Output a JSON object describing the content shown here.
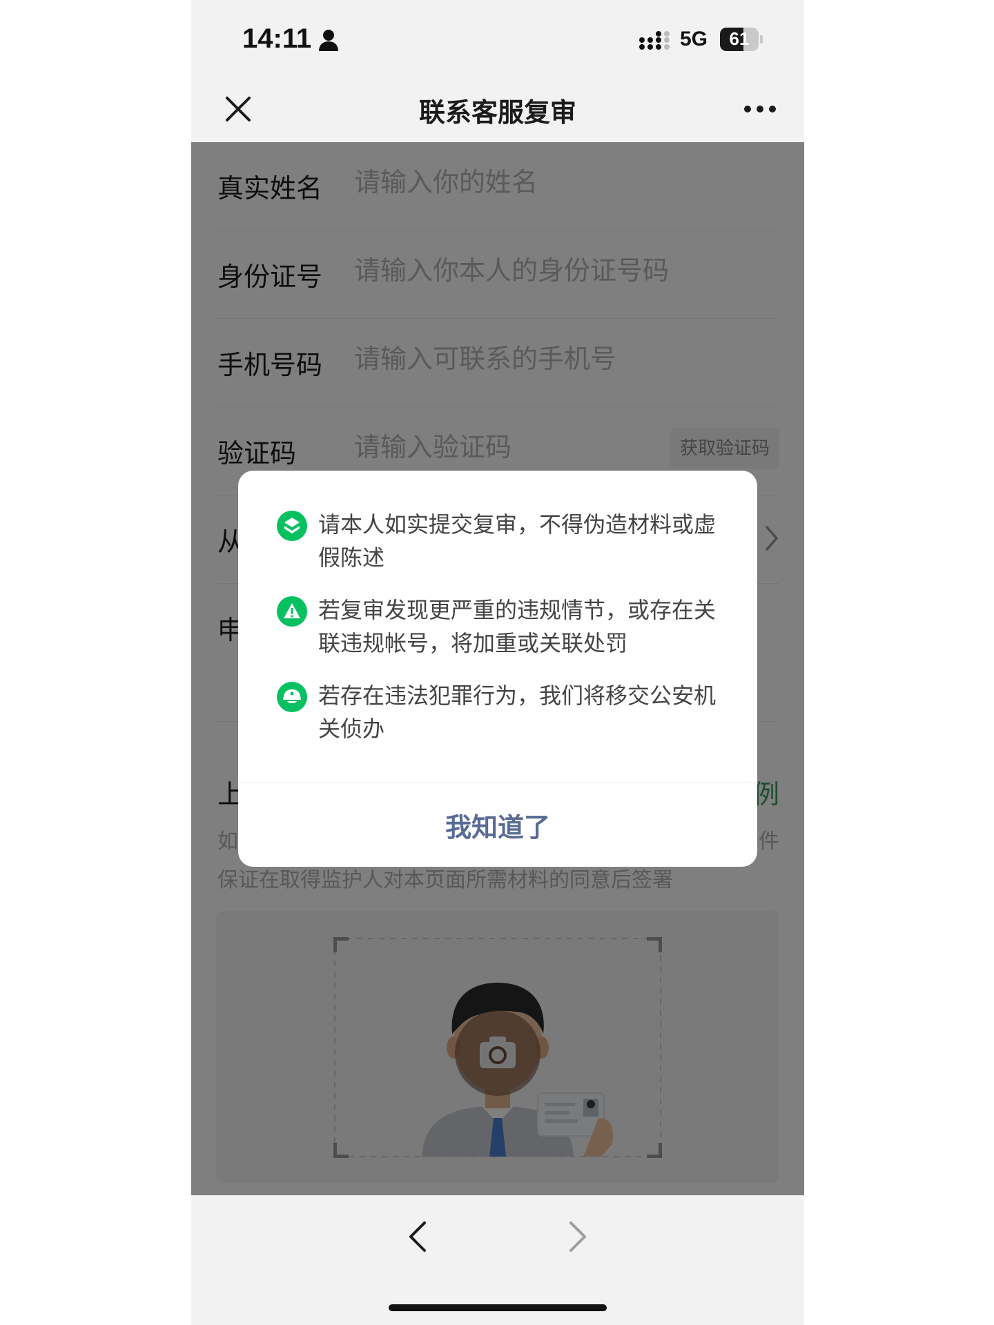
{
  "status_bar": {
    "time": "14:11",
    "network": "5G",
    "battery_level": "61",
    "battery_fraction": 0.61,
    "icons": [
      "person-icon",
      "signal-icon",
      "battery-icon"
    ]
  },
  "nav": {
    "title": "联系客服复审",
    "close_icon": "close-icon",
    "more_icon": "more-icon"
  },
  "form": {
    "name": {
      "label": "真实姓名",
      "placeholder": "请输入你的姓名"
    },
    "id_number": {
      "label": "身份证号",
      "placeholder": "请输入你本人的身份证号码"
    },
    "phone": {
      "label": "手机号码",
      "placeholder": "请输入可联系的手机号"
    },
    "code": {
      "label": "验证码",
      "placeholder": "请输入验证码",
      "button": "获取验证码"
    },
    "from_row_label_partial": "从",
    "appeal_row_label_partial": "申",
    "upload_title_partial": "上",
    "upload_example_partial": "例",
    "upload_hint_line1_partial": "如",
    "upload_hint_line1_end_partial": "件",
    "upload_hint_line2": "保证在取得监护人对本页面所需材料的同意后签署"
  },
  "dialog": {
    "items": [
      {
        "icon": "shield-check-icon",
        "text": "请本人如实提交复审，不得伪造材料或虚假陈述"
      },
      {
        "icon": "warning-icon",
        "text": "若复审发现更严重的违规情节，或存在关联违规帐号，将加重或关联处罚"
      },
      {
        "icon": "police-icon",
        "text": "若存在违法犯罪行为，我们将移交公安机关侦办"
      }
    ],
    "confirm_label": "我知道了"
  },
  "toolbar": {
    "back_icon": "back-arrow-icon",
    "forward_icon": "forward-arrow-icon"
  },
  "colors": {
    "accent_green": "#07c160",
    "link_blue": "#576b95",
    "overlay": "rgba(0,0,0,0.5)"
  }
}
